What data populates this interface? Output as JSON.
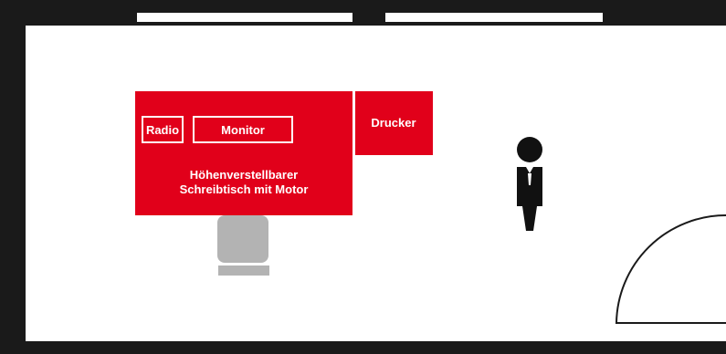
{
  "colors": {
    "wall": "#1a1a1a",
    "furniture": "#e1001a",
    "chair": "#b3b3b3",
    "floor": "#ffffff",
    "person": "#111111"
  },
  "furniture": {
    "radio_label": "Radio",
    "monitor_label": "Monitor",
    "desk_label_line1": "Höhenverstellbarer",
    "desk_label_line2": "Schreibtisch mit Motor",
    "printer_label": "Drucker"
  },
  "icons": {
    "person": "person-icon",
    "chair": "chair-icon",
    "door": "door-swing-icon"
  }
}
